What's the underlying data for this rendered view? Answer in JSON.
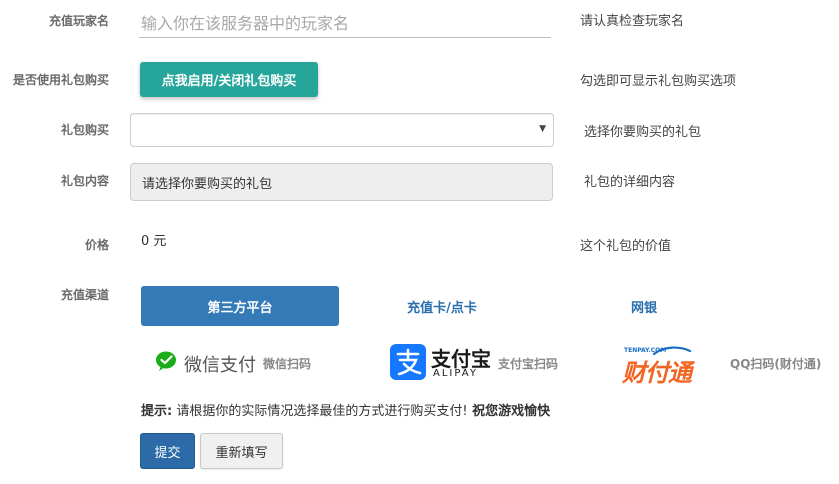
{
  "player": {
    "label": "充值玩家名",
    "placeholder": "输入你在该服务器中的玩家名",
    "hint": "请认真检查玩家名"
  },
  "use_gift": {
    "label": "是否使用礼包购买",
    "button": "点我启用/关闭礼包购买",
    "hint": "勾选即可显示礼包购买选项"
  },
  "gift_select": {
    "label": "礼包购买",
    "value": "",
    "arrow": "▼",
    "hint": "选择你要购买的礼包"
  },
  "gift_content": {
    "label": "礼包内容",
    "value": "请选择你要购买的礼包",
    "hint": "礼包的详细内容"
  },
  "price": {
    "label": "价格",
    "value": "0 元",
    "hint": "这个礼包的价值"
  },
  "channel": {
    "label": "充值渠道",
    "tabs": [
      {
        "label": "第三方平台",
        "active": true
      },
      {
        "label": "充值卡/点卡",
        "active": false
      },
      {
        "label": "网银",
        "active": false
      }
    ]
  },
  "payments": {
    "wechat": {
      "logo_text": "微信支付",
      "caption": "微信扫码",
      "icon": "wechat-icon",
      "color": "#1aad19"
    },
    "alipay": {
      "logo_cn": "支付宝",
      "logo_en": "ALIPAY",
      "caption": "支付宝扫码",
      "icon": "alipay-icon",
      "color": "#1677ff"
    },
    "tenpay": {
      "logo_text": "财付通",
      "small": "TENPAY.COM",
      "caption": "QQ扫码(财付通)",
      "icon": "tenpay-icon",
      "color_main": "#f26522",
      "color_accent": "#1a6fc4"
    }
  },
  "notice": {
    "prefix": "提示:",
    "body": " 请根据你的实际情况选择最佳的方式进行购买支付!",
    "wish": " 祝您游戏愉快"
  },
  "actions": {
    "submit": "提交",
    "reset": "重新填写"
  }
}
